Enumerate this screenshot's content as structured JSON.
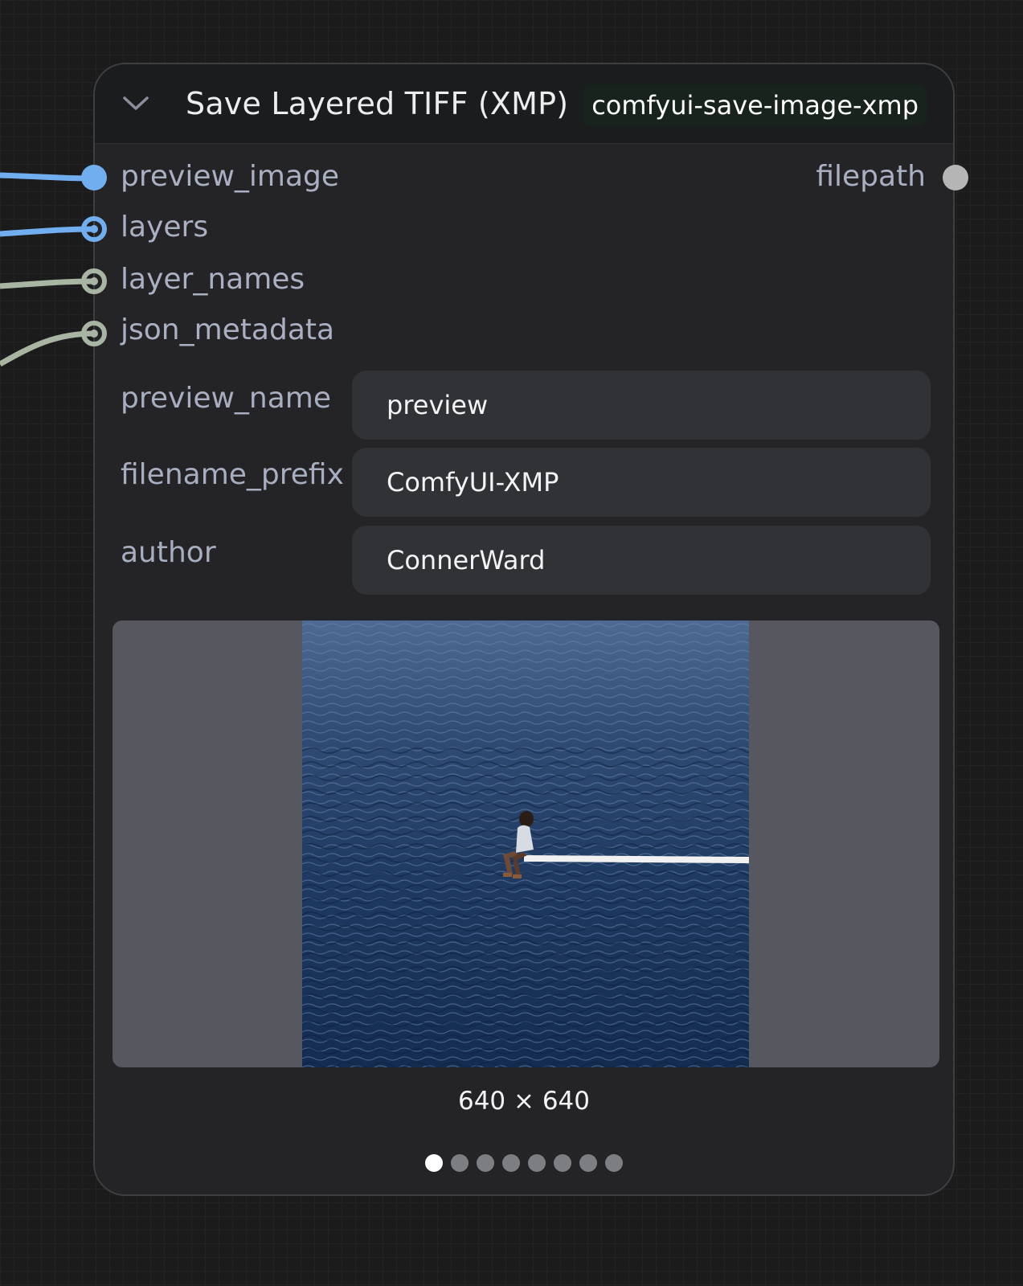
{
  "node": {
    "title": "Save Layered TIFF (XMP)",
    "badge": "comfyui-save-image-xmp",
    "collapse_icon": "chevron-down-icon",
    "inputs": [
      {
        "name": "preview_image",
        "color": "#71aef0",
        "connected": true
      },
      {
        "name": "layers",
        "color": "#71aef0",
        "connected": true
      },
      {
        "name": "layer_names",
        "color": "#a9b5a3",
        "connected": true
      },
      {
        "name": "json_metadata",
        "color": "#a9b5a3",
        "connected": true
      }
    ],
    "outputs": [
      {
        "name": "filepath",
        "color": "#b5b5b5",
        "connected": false
      }
    ],
    "widgets": [
      {
        "label": "preview_name",
        "value": "preview"
      },
      {
        "label": "filename_prefix",
        "value": "ComfyUI-XMP"
      },
      {
        "label": "author",
        "value": "ConnerWard"
      }
    ],
    "preview": {
      "dimensions": "640 × 640",
      "total_images": 8,
      "current_index": 1
    }
  },
  "colors": {
    "canvas_bg": "#1b1b1c",
    "node_bg": "#242427",
    "header_bg": "#1b1c1e",
    "badge_bg": "#17231c",
    "image_wire": "#71aef0",
    "string_wire": "#a9b5a3"
  }
}
